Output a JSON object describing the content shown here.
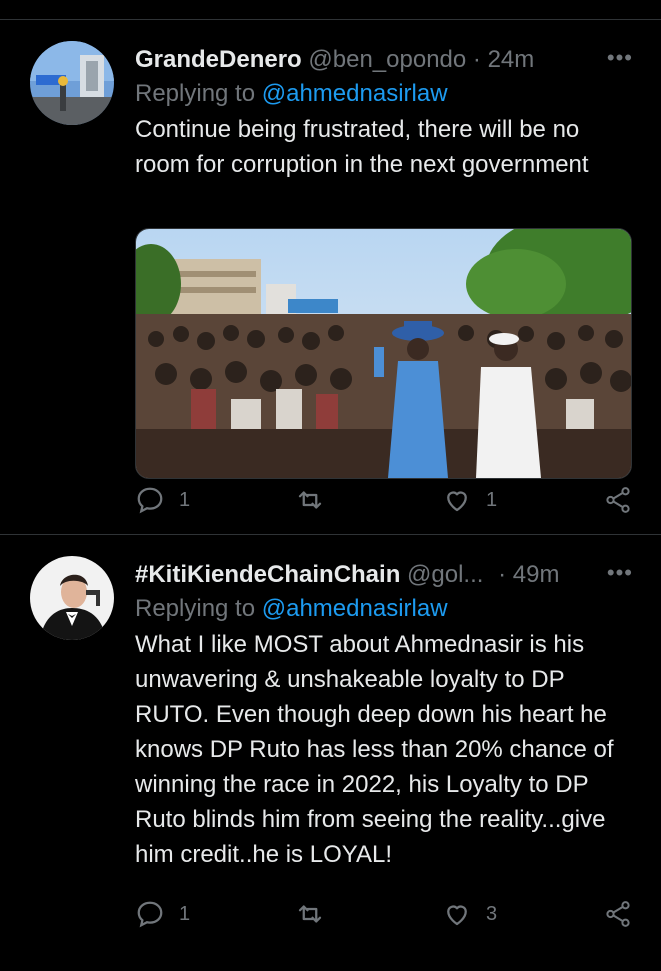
{
  "tweets": [
    {
      "display_name": "GrandeDenero",
      "handle": "@ben_opondo",
      "separator": "·",
      "time": "24m",
      "more": "•••",
      "replying_prefix": "Replying to ",
      "replying_to": "@ahmednasirlaw",
      "text": "Continue being frustrated, there will be no room for corruption in the next government",
      "reply_count": "1",
      "retweet_count": "",
      "like_count": "1"
    },
    {
      "display_name": "#KitiKiendeChainChain",
      "handle": "@gol...",
      "separator": "·",
      "time": "49m",
      "more": "•••",
      "replying_prefix": "Replying to ",
      "replying_to": "@ahmednasirlaw",
      "text": "What I like MOST about Ahmednasir is his unwavering & unshakeable loyalty to DP RUTO. Even though deep down his heart he knows DP Ruto has less than 20% chance of winning the race in 2022, his Loyalty to DP Ruto blinds him from seeing the reality...give him credit..he is LOYAL!",
      "reply_count": "1",
      "retweet_count": "",
      "like_count": "3"
    }
  ],
  "icons": [
    "reply-icon",
    "retweet-icon",
    "like-icon",
    "share-icon"
  ],
  "colors": {
    "background": "#000000",
    "text": "#e7e9ea",
    "muted": "#71767b",
    "link": "#1d9bf0",
    "divider": "#2f3336"
  }
}
